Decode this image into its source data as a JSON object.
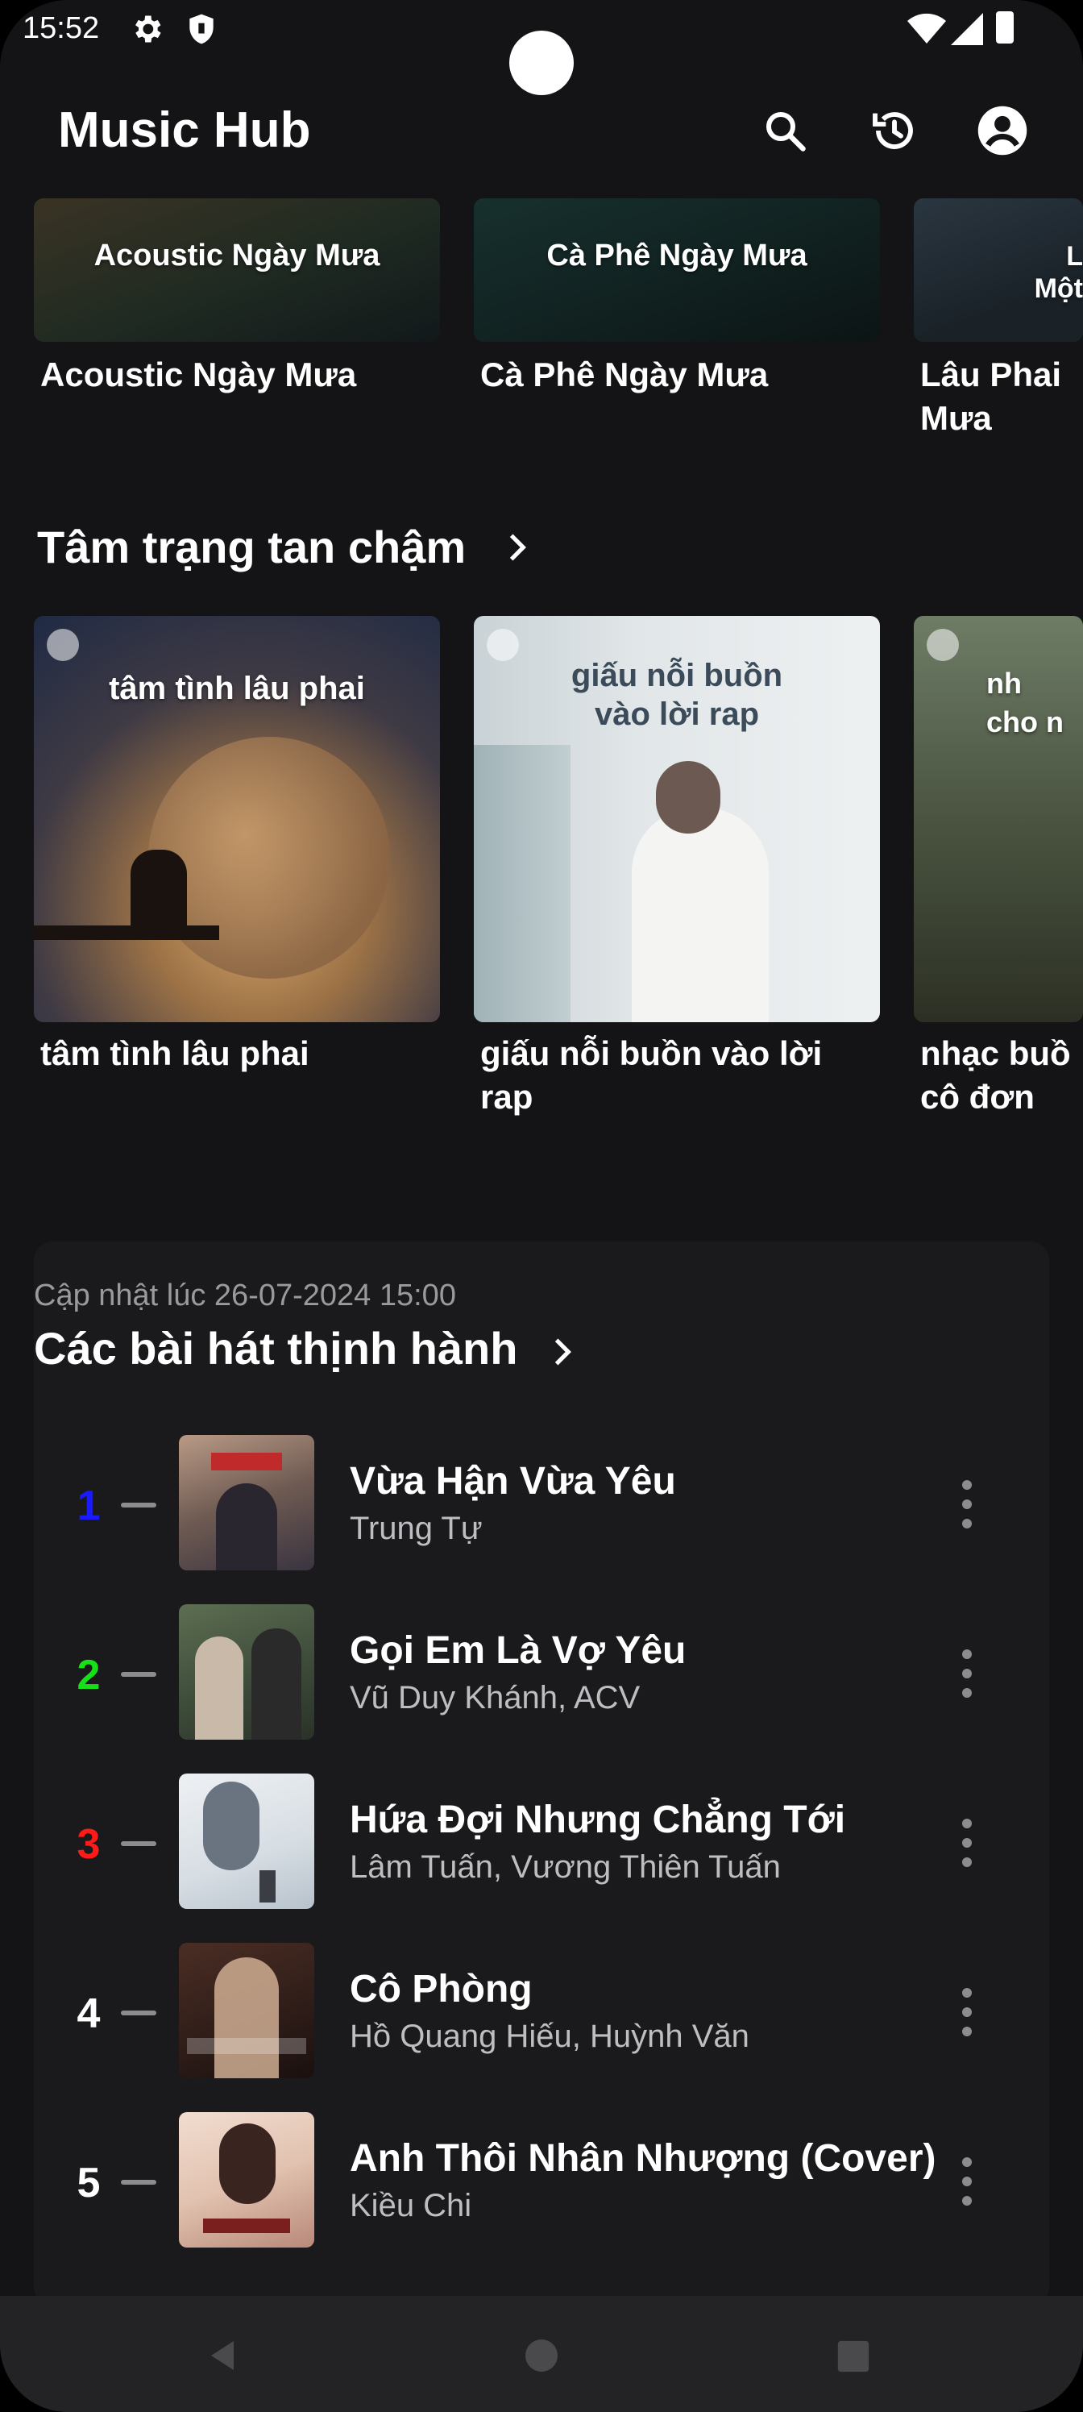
{
  "status_bar": {
    "time": "15:52",
    "icons": [
      "gear-icon",
      "shield-icon",
      "wifi-icon",
      "cellular-icon",
      "battery-icon"
    ]
  },
  "app_bar": {
    "title": "Music Hub",
    "actions": [
      "search-icon",
      "history-icon",
      "account-circle-icon"
    ]
  },
  "rain_playlists": [
    {
      "title": "Acoustic Ngày Mưa",
      "cover_text": "Acoustic Ngày Mưa"
    },
    {
      "title": "Cà Phê Ngày Mưa",
      "cover_text": "Cà Phê Ngày Mưa"
    },
    {
      "title": "Lâu Phai\nMưa",
      "cover_text": "L\nMột"
    }
  ],
  "mood_section": {
    "title": "Tâm trạng tan chậm",
    "playlists": [
      {
        "title": "tâm tình lâu phai",
        "cover_text": "tâm tình lâu phai"
      },
      {
        "title": "giấu nỗi buồn vào lời\nrap",
        "cover_text": "giấu nỗi buồn\nvào lời rap"
      },
      {
        "title": "nhạc buồ\ncô đơn",
        "cover_text": "nh\ncho n"
      }
    ]
  },
  "trending": {
    "updated": "Cập nhật lúc 26-07-2024 15:00",
    "title": "Các bài hát thịnh hành",
    "songs": [
      {
        "rank": "1",
        "title": "Vừa Hận Vừa Yêu",
        "artist": "Trung Tự",
        "rank_color": "#1a1aff"
      },
      {
        "rank": "2",
        "title": "Gọi Em Là Vợ Yêu",
        "artist": "Vũ Duy Khánh, ACV",
        "rank_color": "#18e018"
      },
      {
        "rank": "3",
        "title": "Hứa Đợi Nhưng Chẳng Tới",
        "artist": "Lâm Tuấn, Vương Thiên Tuấn",
        "rank_color": "#ff1a1a"
      },
      {
        "rank": "4",
        "title": "Cô Phòng",
        "artist": "Hồ Quang Hiếu, Huỳnh Văn",
        "rank_color": "#ffffff"
      },
      {
        "rank": "5",
        "title": "Anh Thôi Nhân Nhượng (Cover)",
        "artist": "Kiều Chi",
        "rank_color": "#ffffff"
      }
    ]
  },
  "nav_bar": {
    "buttons": [
      "back-icon",
      "home-icon",
      "recents-icon"
    ]
  }
}
